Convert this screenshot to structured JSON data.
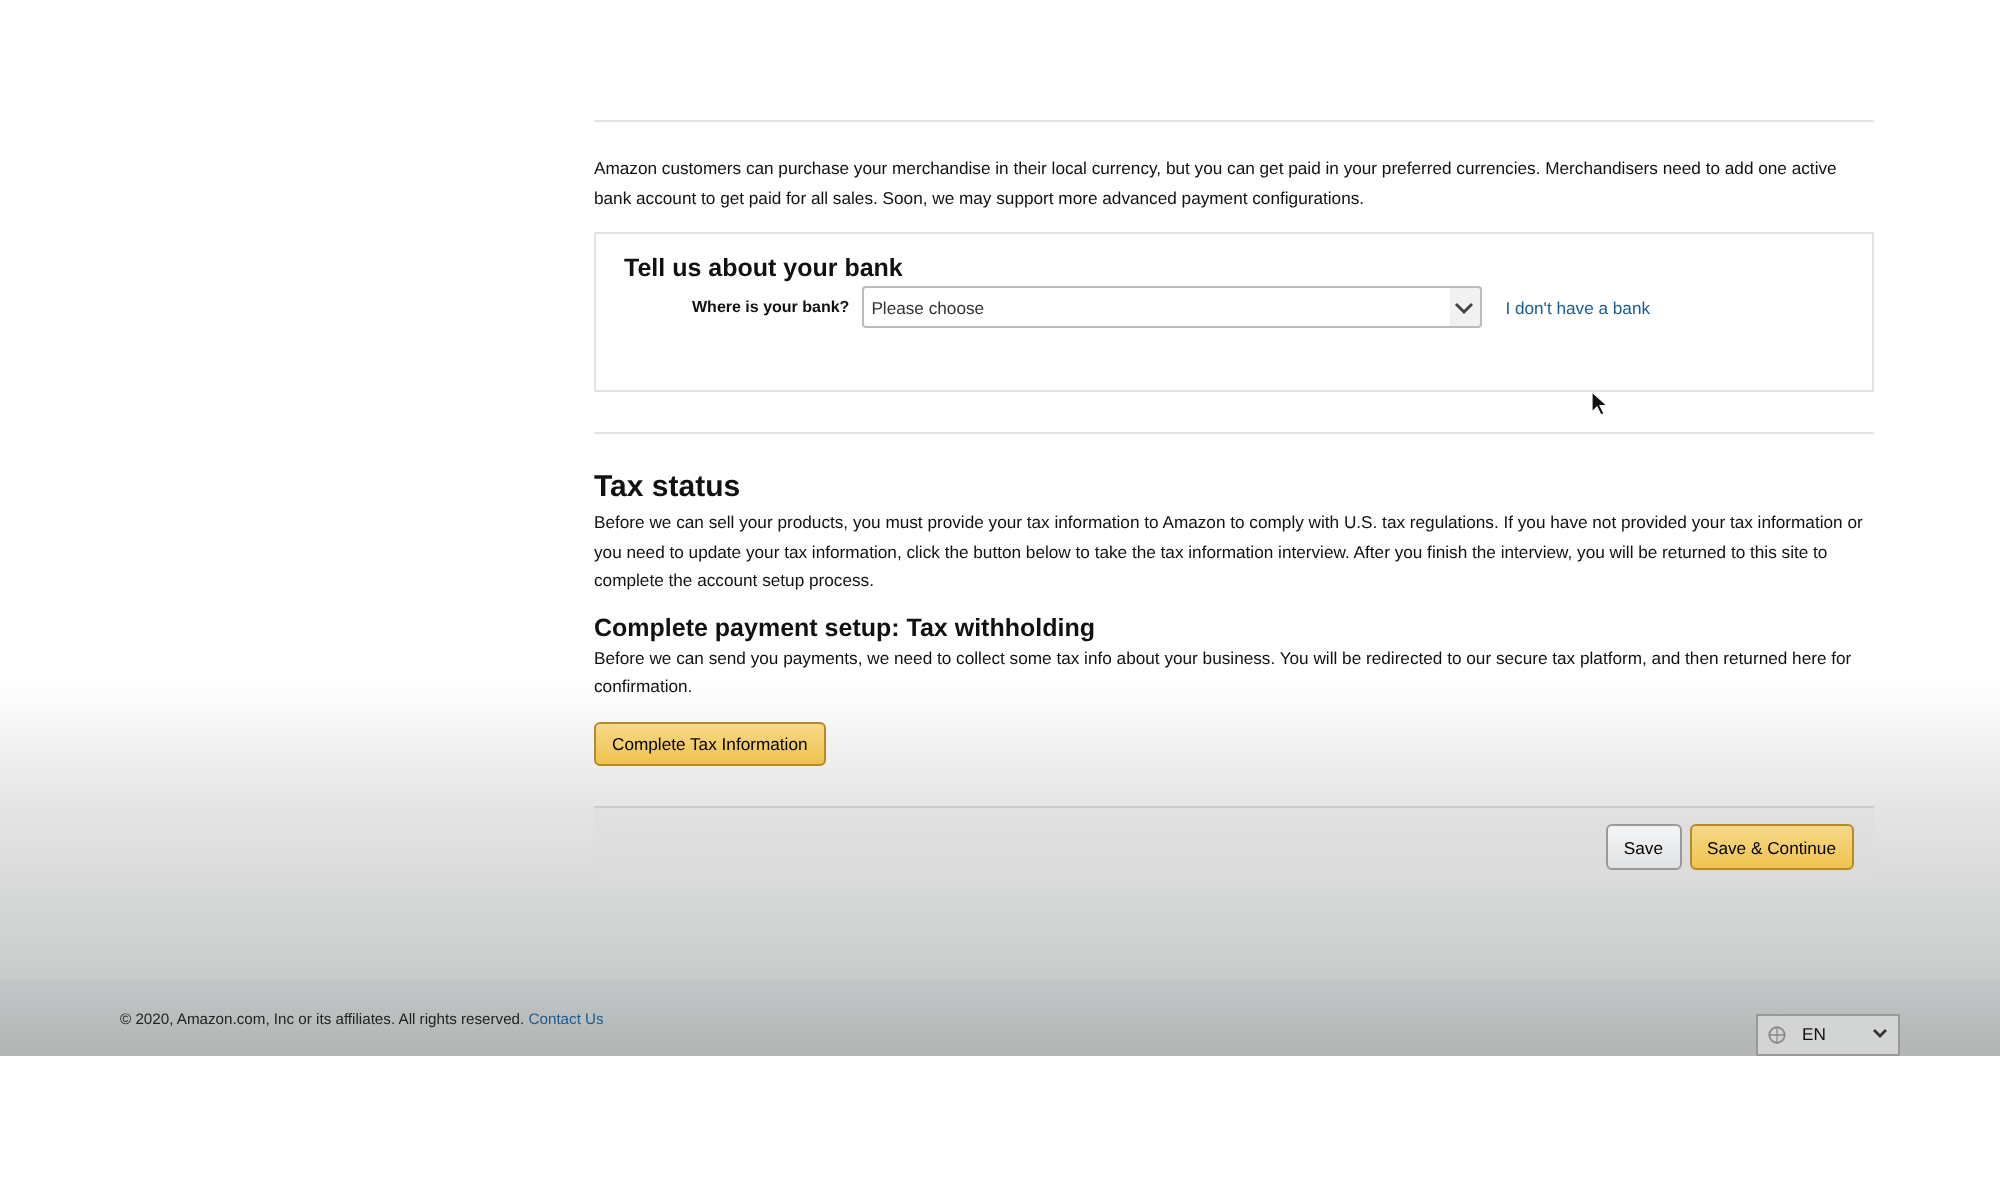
{
  "intro": "Amazon customers can purchase your merchandise in their local currency, but you can get paid in your preferred currencies. Merchandisers need to add one active bank account to get paid for all sales. Soon, we may support more advanced payment configurations.",
  "bank": {
    "title": "Tell us about your bank",
    "label": "Where is your bank?",
    "select": {
      "value": "Please choose"
    },
    "link": "I don't have a bank"
  },
  "tax_status": {
    "title": "Tax status",
    "text": "Before we can sell your products, you must provide your tax information to Amazon to comply with U.S. tax regulations. If you have not provided your tax information or you need to update your tax information, click the button below to take the tax information interview. After you finish the interview, you will be returned to this site to complete the account setup process."
  },
  "payment_setup": {
    "title": "Complete payment setup: Tax withholding",
    "text": "Before we can send you payments, we need to collect some tax info about your business. You will be redirected to our secure tax platform, and then returned here for confirmation.",
    "button": "Complete Tax Information"
  },
  "actions": [
    {
      "label": "Save",
      "kind": "secondary"
    },
    {
      "label": "Save & Continue",
      "kind": "primary"
    }
  ],
  "footer": {
    "copyright": "© 2020, Amazon.com, Inc or its affiliates. All rights reserved.",
    "link": "Contact Us",
    "language": "EN"
  }
}
